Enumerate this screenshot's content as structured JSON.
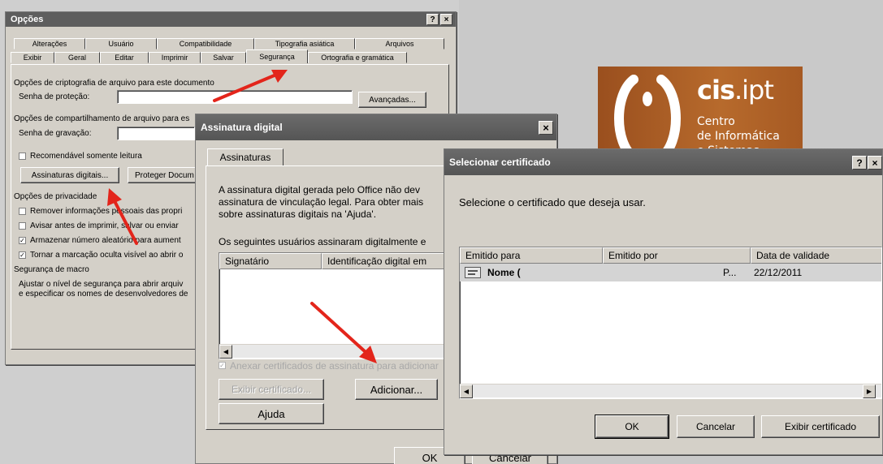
{
  "options_dialog": {
    "title": "Opções",
    "help_btn": "?",
    "close_btn": "×",
    "tabs_row1": [
      "Alterações",
      "Usuário",
      "Compatibilidade",
      "Tipografia asiática",
      "Arquivos"
    ],
    "tabs_row2": [
      "Exibir",
      "Geral",
      "Editar",
      "Imprimir",
      "Salvar",
      "Segurança",
      "Ortografia e gramática"
    ],
    "active_tab": "Segurança",
    "encrypt_section": "Opções de criptografia de arquivo para este documento",
    "open_password_label": "Senha de proteção:",
    "advanced_button": "Avançadas...",
    "share_section": "Opções de compartilhamento de arquivo para es",
    "modify_password_label": "Senha de gravação:",
    "readonly_checkbox": "Recomendável somente leitura",
    "digital_signatures_button": "Assinaturas digitais...",
    "protect_document_button": "Proteger Docum",
    "privacy_section": "Opções de privacidade",
    "privacy_options": [
      {
        "label": "Remover informações pessoais das propri",
        "checked": false
      },
      {
        "label": "Avisar antes de imprimir, salvar ou enviar",
        "checked": false
      },
      {
        "label": "Armazenar número aleatório para aument",
        "checked": true
      },
      {
        "label": "Tornar a marcação oculta visível ao abrir o",
        "checked": true
      }
    ],
    "macro_section": "Segurança de macro",
    "macro_text_1": "Ajustar o nível de segurança para abrir arquiv",
    "macro_text_2": "e especificar os nomes de desenvolvedores de"
  },
  "signature_dialog": {
    "title": "Assinatura digital",
    "close_btn": "×",
    "tab": "Assinaturas",
    "info_line_1": "A assinatura digital gerada pelo Office não dev",
    "info_line_2": "assinatura de vinculação legal. Para obter mais",
    "info_line_3": "sobre assinaturas digitais na 'Ajuda'.",
    "signed_by_label": "Os seguintes usuários assinaram digitalmente e",
    "columns": [
      "Signatário",
      "Identificação digital em"
    ],
    "attach_checkbox": "Anexar certificados de assinatura para adicionar",
    "view_cert_button": "Exibir certificado...",
    "add_button": "Adicionar...",
    "help_button": "Ajuda",
    "ok_button": "OK",
    "cancel_button": "Cancelar"
  },
  "select_cert_dialog": {
    "title": "Selecionar certificado",
    "help_btn": "?",
    "close_btn": "×",
    "prompt": "Selecione o certificado que deseja usar.",
    "columns": [
      "Emitido para",
      "Emitido por",
      "Data de validade"
    ],
    "rows": [
      {
        "issued_to": "Nome (",
        "issued_by": "P...",
        "expiry": "22/12/2011"
      }
    ],
    "ok_button": "OK",
    "cancel_button": "Cancelar",
    "view_cert_button": "Exibir certificado"
  },
  "logo": {
    "brand_bold": "cis",
    "brand_light": ".ipt",
    "line1": "Centro",
    "line2": "de Informática",
    "line3": "e Sistemas"
  },
  "colors": {
    "titlebar": "#5e5e5e",
    "arrow": "#e3251b",
    "logo_bg": "#b76a2c"
  }
}
